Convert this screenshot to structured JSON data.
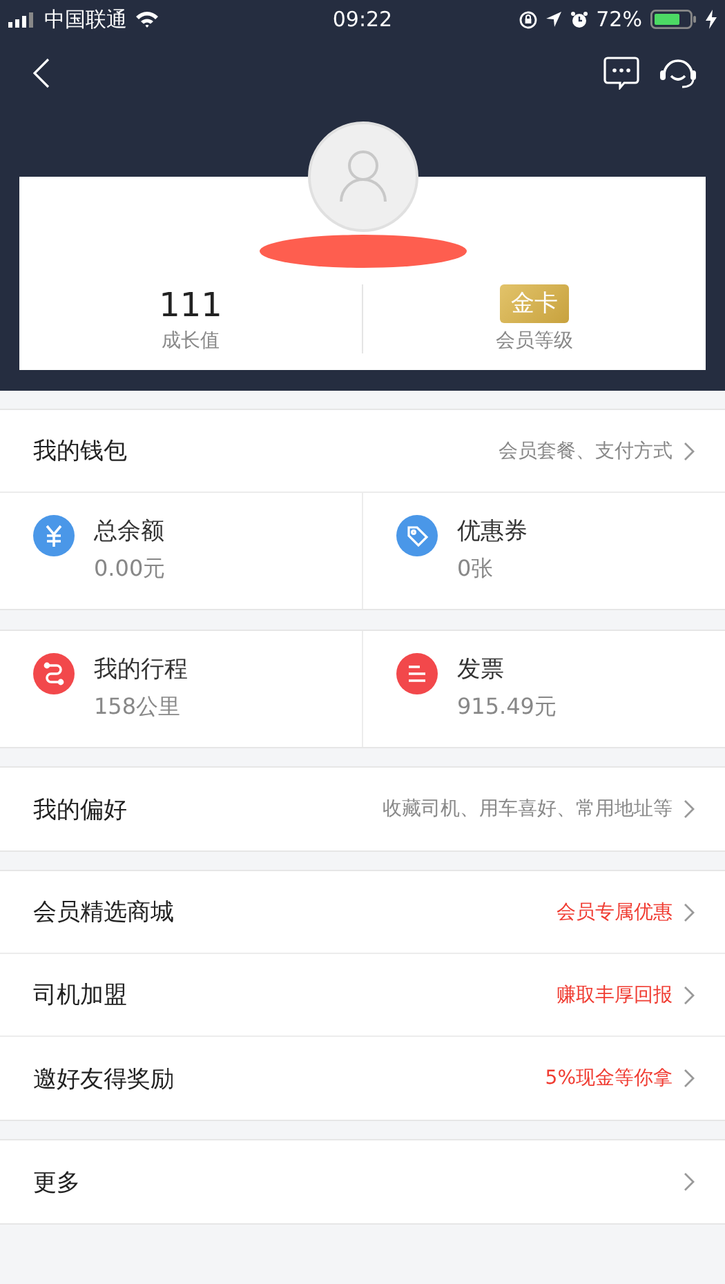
{
  "status_bar": {
    "carrier": "中国联通",
    "time": "09:22",
    "battery": "72%"
  },
  "profile": {
    "stats": [
      {
        "kind": "number",
        "value": "111",
        "label": "成长值"
      },
      {
        "kind": "badge",
        "value": "金卡",
        "label": "会员等级"
      }
    ]
  },
  "wallet": {
    "title": "我的钱包",
    "detail": "会员套餐、支付方式"
  },
  "tile_groups": [
    {
      "tiles": [
        {
          "title": "总余额",
          "value": "0.00元",
          "color": "#4a97e8"
        },
        {
          "title": "优惠券",
          "value": "0张",
          "color": "#4a97e8"
        }
      ]
    },
    {
      "tiles": [
        {
          "title": "我的行程",
          "value": "158公里",
          "color": "#f2484b"
        },
        {
          "title": "发票",
          "value": "915.49元",
          "color": "#f2484b"
        }
      ]
    }
  ],
  "sections": [
    [
      {
        "title": "我的偏好",
        "detail": "收藏司机、用车喜好、常用地址等",
        "highlight": false
      }
    ],
    [
      {
        "title": "会员精选商城",
        "detail": "会员专属优惠",
        "highlight": true
      },
      {
        "title": "司机加盟",
        "detail": "赚取丰厚回报",
        "highlight": true
      },
      {
        "title": "邀好友得奖励",
        "detail": "5%现金等你拿",
        "highlight": true
      }
    ],
    [
      {
        "title": "更多"
      }
    ]
  ]
}
